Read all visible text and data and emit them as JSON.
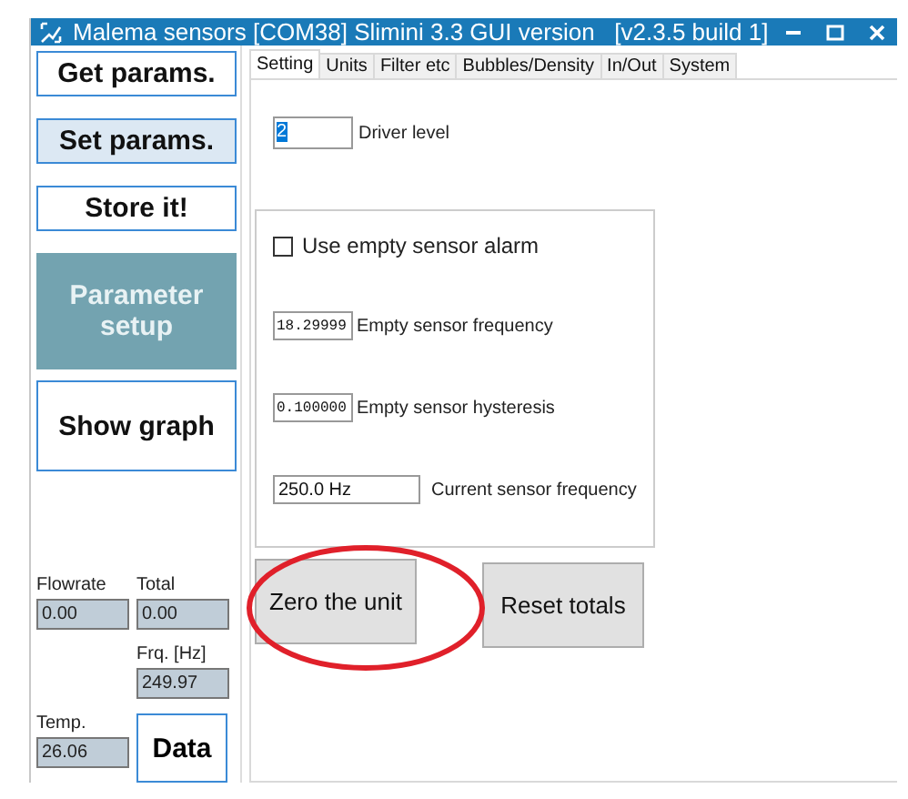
{
  "window": {
    "title": "Malema sensors [COM38] Slimini 3.3 GUI version   [v2.3.5 build 1]"
  },
  "sidebar": {
    "buttons": [
      {
        "label": "Get params.",
        "kind": "plain"
      },
      {
        "label": "Set params.",
        "kind": "hover"
      },
      {
        "label": "Store it!",
        "kind": "plain"
      },
      {
        "label": "Parameter setup",
        "kind": "active"
      },
      {
        "label": "Show graph",
        "kind": "large"
      }
    ],
    "readouts": [
      {
        "label": "Flowrate",
        "value": "0.00"
      },
      {
        "label": "Total",
        "value": "0.00"
      },
      {
        "label": "Frq. [Hz]",
        "value": "249.97"
      },
      {
        "label": "Temp.",
        "value": "26.06"
      }
    ],
    "data_button": "Data"
  },
  "tabs": [
    {
      "label": "Setting",
      "selected": true
    },
    {
      "label": "Units",
      "selected": false
    },
    {
      "label": "Filter etc",
      "selected": false
    },
    {
      "label": "Bubbles/Density",
      "selected": false
    },
    {
      "label": "In/Out",
      "selected": false
    },
    {
      "label": "System",
      "selected": false
    }
  ],
  "setting": {
    "driver_level": {
      "value": "2",
      "label": "Driver level"
    },
    "alarm": {
      "label": "Use empty sensor alarm",
      "checked": false
    },
    "fields": [
      {
        "value": "18.29999",
        "label": "Empty sensor frequency",
        "kind": "narrow"
      },
      {
        "value": "0.100000",
        "label": "Empty sensor hysteresis",
        "kind": "narrow"
      },
      {
        "value": "250.0 Hz",
        "label": "Current sensor frequency",
        "kind": "wide"
      }
    ],
    "buttons": [
      "Zero the unit",
      "Reset totals"
    ]
  }
}
